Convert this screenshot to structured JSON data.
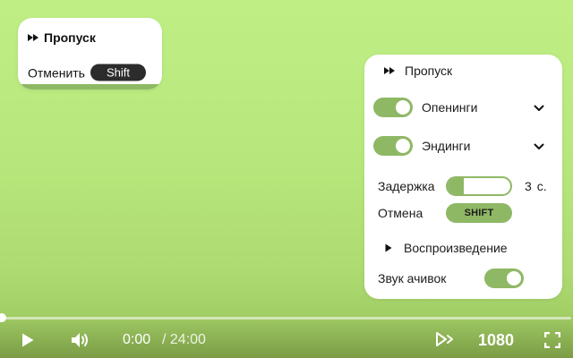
{
  "toast": {
    "title": "Пропуск",
    "cancel_label": "Отменить",
    "key_label": "Shift",
    "progress_fraction": 1.0
  },
  "panel": {
    "header": "Пропуск",
    "openings": {
      "label": "Опенинги",
      "enabled": true
    },
    "endings": {
      "label": "Эндинги",
      "enabled": true
    },
    "delay": {
      "label": "Задержка",
      "value": "3",
      "unit": "с.",
      "fill_fraction": 0.25
    },
    "cancel": {
      "label": "Отмена",
      "key": "SHIFT"
    },
    "playback_header": "Воспроизведение",
    "achievement_sound": {
      "label": "Звук ачивок",
      "enabled": true
    }
  },
  "controls": {
    "current_time": "0:00",
    "total_time": "/ 24:00",
    "quality": "1080",
    "progress_fraction": 0.0
  },
  "colors": {
    "accent": "#8fb865",
    "background_top": "#bfee85",
    "background_bottom": "#98c35c",
    "panel_bg": "#ffffff",
    "key_dark": "#2c2c2c"
  },
  "icons": [
    "skip-forward-icon",
    "chevron-down-icon",
    "play-icon",
    "volume-icon",
    "autoplay-icon",
    "fullscreen-icon"
  ]
}
